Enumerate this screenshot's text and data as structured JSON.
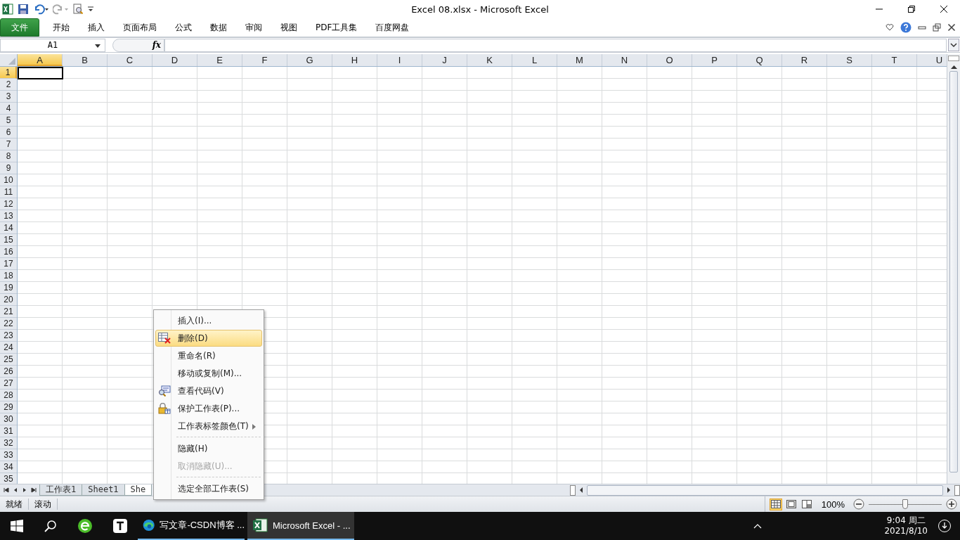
{
  "window": {
    "title": "Excel 08.xlsx  -  Microsoft Excel"
  },
  "ribbon_tabs": [
    {
      "label": "文件",
      "kind": "file",
      "selected": false
    },
    {
      "label": "开始",
      "kind": "tab",
      "selected": false
    },
    {
      "label": "插入",
      "kind": "tab",
      "selected": false
    },
    {
      "label": "页面布局",
      "kind": "tab",
      "selected": false
    },
    {
      "label": "公式",
      "kind": "tab",
      "selected": false
    },
    {
      "label": "数据",
      "kind": "tab",
      "selected": false
    },
    {
      "label": "审阅",
      "kind": "tab",
      "selected": false
    },
    {
      "label": "视图",
      "kind": "tab",
      "selected": false
    },
    {
      "label": "PDF工具集",
      "kind": "tab",
      "selected": false
    },
    {
      "label": "百度网盘",
      "kind": "tab",
      "selected": false
    }
  ],
  "formula_bar": {
    "name_box": "A1",
    "fx": "fx"
  },
  "columns": [
    {
      "label": "A",
      "selected": true
    },
    {
      "label": "B",
      "selected": false
    },
    {
      "label": "C",
      "selected": false
    },
    {
      "label": "D",
      "selected": false
    },
    {
      "label": "E",
      "selected": false
    },
    {
      "label": "F",
      "selected": false
    },
    {
      "label": "G",
      "selected": false
    },
    {
      "label": "H",
      "selected": false
    },
    {
      "label": "I",
      "selected": false
    },
    {
      "label": "J",
      "selected": false
    },
    {
      "label": "K",
      "selected": false
    },
    {
      "label": "L",
      "selected": false
    },
    {
      "label": "M",
      "selected": false
    },
    {
      "label": "N",
      "selected": false
    },
    {
      "label": "O",
      "selected": false
    },
    {
      "label": "P",
      "selected": false
    },
    {
      "label": "Q",
      "selected": false
    },
    {
      "label": "R",
      "selected": false
    },
    {
      "label": "S",
      "selected": false
    },
    {
      "label": "T",
      "selected": false
    },
    {
      "label": "U",
      "selected": false
    }
  ],
  "rows": [
    {
      "label": "1",
      "selected": true
    },
    {
      "label": "2",
      "selected": false
    },
    {
      "label": "3",
      "selected": false
    },
    {
      "label": "4",
      "selected": false
    },
    {
      "label": "5",
      "selected": false
    },
    {
      "label": "6",
      "selected": false
    },
    {
      "label": "7",
      "selected": false
    },
    {
      "label": "8",
      "selected": false
    },
    {
      "label": "9",
      "selected": false
    },
    {
      "label": "10",
      "selected": false
    },
    {
      "label": "11",
      "selected": false
    },
    {
      "label": "12",
      "selected": false
    },
    {
      "label": "13",
      "selected": false
    },
    {
      "label": "14",
      "selected": false
    },
    {
      "label": "15",
      "selected": false
    },
    {
      "label": "16",
      "selected": false
    },
    {
      "label": "17",
      "selected": false
    },
    {
      "label": "18",
      "selected": false
    },
    {
      "label": "19",
      "selected": false
    },
    {
      "label": "20",
      "selected": false
    },
    {
      "label": "21",
      "selected": false
    },
    {
      "label": "22",
      "selected": false
    },
    {
      "label": "23",
      "selected": false
    },
    {
      "label": "24",
      "selected": false
    },
    {
      "label": "25",
      "selected": false
    },
    {
      "label": "26",
      "selected": false
    },
    {
      "label": "27",
      "selected": false
    },
    {
      "label": "28",
      "selected": false
    },
    {
      "label": "29",
      "selected": false
    },
    {
      "label": "30",
      "selected": false
    },
    {
      "label": "31",
      "selected": false
    },
    {
      "label": "32",
      "selected": false
    },
    {
      "label": "33",
      "selected": false
    },
    {
      "label": "34",
      "selected": false
    },
    {
      "label": "35",
      "selected": false
    }
  ],
  "sheet_tabs": [
    {
      "label": "工作表1",
      "selected": false
    },
    {
      "label": "Sheet1",
      "selected": false
    },
    {
      "label": "She",
      "selected": true
    }
  ],
  "context_menu": [
    {
      "kind": "item",
      "label": "插入(I)...",
      "selected": false,
      "disabled": false,
      "submenu": false
    },
    {
      "kind": "item",
      "label": "删除(D)",
      "selected": true,
      "disabled": false,
      "submenu": false
    },
    {
      "kind": "item",
      "label": "重命名(R)",
      "selected": false,
      "disabled": false,
      "submenu": false
    },
    {
      "kind": "item",
      "label": "移动或复制(M)...",
      "selected": false,
      "disabled": false,
      "submenu": false
    },
    {
      "kind": "item",
      "label": "查看代码(V)",
      "selected": false,
      "disabled": false,
      "submenu": false
    },
    {
      "kind": "item",
      "label": "保护工作表(P)...",
      "selected": false,
      "disabled": false,
      "submenu": false
    },
    {
      "kind": "item",
      "label": "工作表标签颜色(T)",
      "selected": false,
      "disabled": false,
      "submenu": true
    },
    {
      "kind": "separator"
    },
    {
      "kind": "item",
      "label": "隐藏(H)",
      "selected": false,
      "disabled": false,
      "submenu": false
    },
    {
      "kind": "item",
      "label": "取消隐藏(U)...",
      "selected": false,
      "disabled": true,
      "submenu": false
    },
    {
      "kind": "separator"
    },
    {
      "kind": "item",
      "label": "选定全部工作表(S)",
      "selected": false,
      "disabled": false,
      "submenu": false
    }
  ],
  "status_bar": {
    "items": [
      "就绪",
      "滚动"
    ],
    "views": [
      {
        "kind": "normal",
        "selected": true
      },
      {
        "kind": "layout",
        "selected": false
      },
      {
        "kind": "break",
        "selected": false
      }
    ],
    "zoom": "100%",
    "zoom_slider": {
      "level": 0.5
    }
  },
  "taskbar": {
    "apps": [
      {
        "kind": "browser360",
        "active": false
      },
      {
        "kind": "typora",
        "active": false
      },
      {
        "kind": "edge",
        "label": "写文章-CSDN博客 ...",
        "active": false
      },
      {
        "kind": "excel",
        "label": "Microsoft Excel - ...",
        "active": true
      }
    ],
    "time": "9:04 周二",
    "date": "2021/8/10"
  }
}
